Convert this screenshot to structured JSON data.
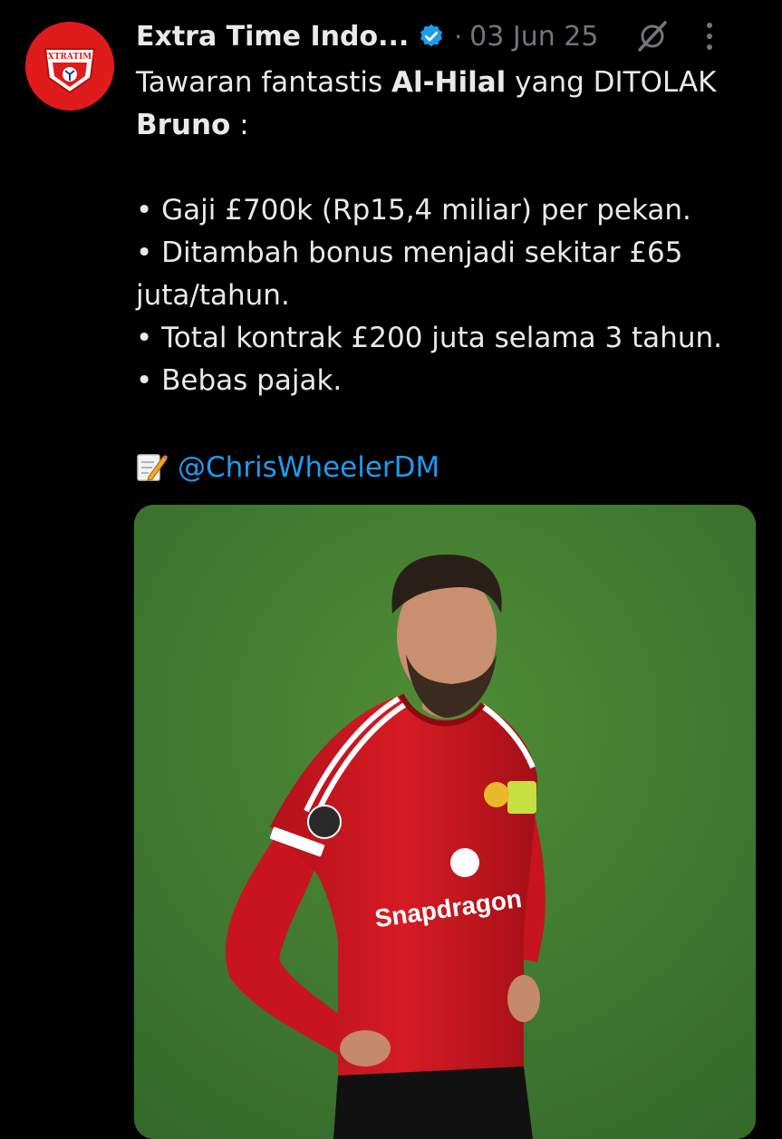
{
  "tweet": {
    "author_name": "Extra Time Indo...",
    "date": "03 Jun 25",
    "separator": "·",
    "avatar_text": "EXTRATIME",
    "line1_pre": "Tawaran fantastis ",
    "line1_bold": "Al-Hilal",
    "line1_post": " yang DITOLAK",
    "line2_bold": "Bruno",
    "line2_post": " :",
    "bullets": [
      "• Gaji £700k (Rp15,4 miliar) per pekan.",
      "• Ditambah bonus menjadi sekitar £65",
      "juta/tahun.",
      "• Total kontrak £200 juta selama 3 tahun.",
      "• Bebas pajak."
    ],
    "mention": "@ChrisWheelerDM"
  },
  "media": {
    "shirt_sponsor": "Snapdragon",
    "colors": {
      "pitch": "#3f7a2b",
      "shirt": "#c8141e",
      "skin": "#c48a6a"
    }
  },
  "icons": {
    "verified": "verified-badge-icon",
    "grok": "grok-icon",
    "more": "more-options-icon",
    "memo": "memo-icon"
  },
  "colors": {
    "background": "#000000",
    "text": "#e7e9ea",
    "muted": "#71767b",
    "link": "#1d9bf0",
    "avatar": "#e01b1b"
  }
}
